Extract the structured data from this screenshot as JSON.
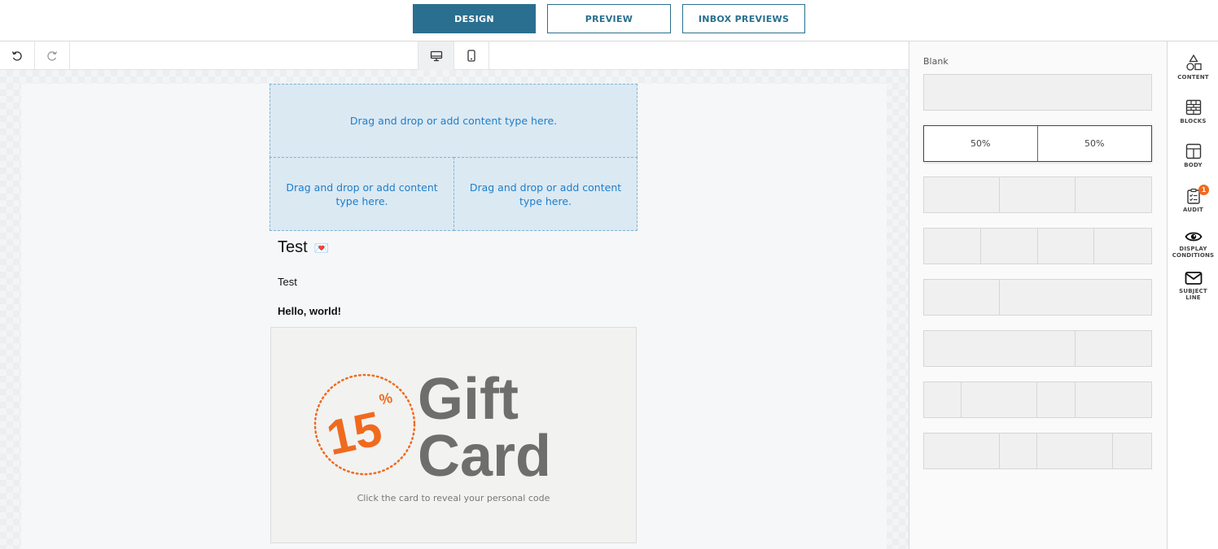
{
  "modes": {
    "design": "DESIGN",
    "preview": "PREVIEW",
    "inbox": "INBOX PREVIEWS"
  },
  "toolbar": {
    "undo_icon": "undo-icon",
    "redo_icon": "redo-icon",
    "desktop_icon": "desktop-icon",
    "mobile_icon": "mobile-icon"
  },
  "canvas": {
    "drop_full": "Drag and drop or add content type here.",
    "drop_left": "Drag and drop or add content type here.",
    "drop_right": "Drag and drop or add content type here.",
    "heading": "Test",
    "heading_emoji": "💌",
    "paragraph": "Test",
    "bold_text": "Hello, world!",
    "giftcard": {
      "percent": "15",
      "percent_sign": "%",
      "line1": "Gift",
      "line2": "Card",
      "caption": "Click the card to reveal your personal code"
    }
  },
  "layouts": {
    "label": "Blank",
    "selected_left": "50%",
    "selected_right": "50%"
  },
  "sidebar": {
    "content": "CONTENT",
    "blocks": "BLOCKS",
    "body": "BODY",
    "audit": "AUDIT",
    "audit_badge": "1",
    "display_1": "DISPLAY",
    "display_2": "CONDITIONS",
    "subject_1": "SUBJECT",
    "subject_2": "LINE"
  },
  "colors": {
    "primary": "#2a6f8f",
    "accent_orange": "#f06a1e",
    "drop_zone": "#dbe9f3",
    "drop_text": "#1e7ec8"
  }
}
